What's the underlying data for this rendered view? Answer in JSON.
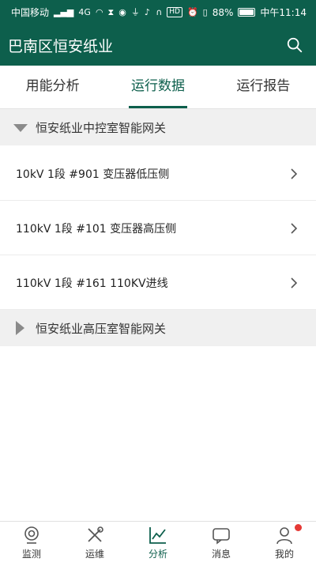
{
  "statusbar": {
    "carrier": "中国移动",
    "signal_badge": "4G",
    "battery": "88%",
    "battery_level": 0.88,
    "time": "中午11:14",
    "hd_badge": "HD"
  },
  "appbar": {
    "title": "巴南区恒安纸业"
  },
  "tabs": [
    {
      "label": "用能分析",
      "active": false
    },
    {
      "label": "运行数据",
      "active": true
    },
    {
      "label": "运行报告",
      "active": false
    }
  ],
  "groups": [
    {
      "label": "恒安纸业中控室智能网关",
      "expanded": true
    },
    {
      "label": "恒安纸业高压室智能网关",
      "expanded": false
    }
  ],
  "rows": [
    {
      "label": "10kV 1段 #901 变压器低压侧"
    },
    {
      "label": "110kV 1段 #101 变压器高压侧"
    },
    {
      "label": "110kV 1段 #161 110KV进线"
    }
  ],
  "bottomnav": [
    {
      "label": "监测",
      "icon": "monitor-icon"
    },
    {
      "label": "运维",
      "icon": "tools-icon"
    },
    {
      "label": "分析",
      "icon": "chart-icon",
      "active": true
    },
    {
      "label": "消息",
      "icon": "message-icon"
    },
    {
      "label": "我的",
      "icon": "user-icon"
    }
  ],
  "colors": {
    "brand": "#0d5f4c",
    "group_bg": "#f0f0f0",
    "badge": "#e53935"
  }
}
